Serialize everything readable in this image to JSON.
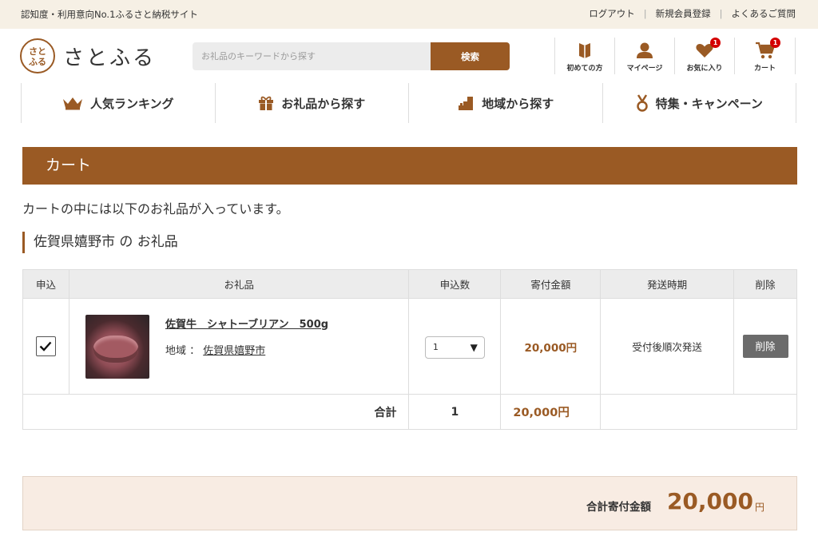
{
  "topbar": {
    "tagline": "認知度・利用意向No.1ふるさと納税サイト",
    "links": [
      "ログアウト",
      "新規会員登録",
      "よくあるご質問"
    ]
  },
  "header": {
    "logo_mark": "さとふる",
    "logo_text": "さとふる",
    "search_placeholder": "お礼品のキーワードから探す",
    "search_button": "検索",
    "icons": [
      {
        "label": "初めての方",
        "icon": "book-icon"
      },
      {
        "label": "マイページ",
        "icon": "user-icon"
      },
      {
        "label": "お気に入り",
        "icon": "heart-icon",
        "badge": "1"
      },
      {
        "label": "カート",
        "icon": "cart-icon",
        "badge": "1"
      }
    ]
  },
  "nav": [
    {
      "label": "人気ランキング",
      "icon": "crown-icon"
    },
    {
      "label": "お礼品から探す",
      "icon": "gift-icon"
    },
    {
      "label": "地域から探す",
      "icon": "map-icon"
    },
    {
      "label": "特集・キャンペーン",
      "icon": "medal-icon"
    }
  ],
  "cart": {
    "title": "カート",
    "intro": "カートの中には以下のお礼品が入っています。",
    "municipality_heading": "佐賀県嬉野市 の お礼品",
    "columns": [
      "申込",
      "お礼品",
      "申込数",
      "寄付金額",
      "発送時期",
      "削除"
    ],
    "items": [
      {
        "checked": true,
        "name": "佐賀牛　シャトーブリアン　500g",
        "region_label": "地域 ：",
        "region": "佐賀県嬉野市",
        "quantity": "1",
        "amount": "20,000円",
        "shipping": "受付後順次発送",
        "delete_label": "削除"
      }
    ],
    "total_label": "合計",
    "total_quantity": "1",
    "total_amount": "20,000円"
  },
  "grand_total": {
    "label": "合計寄付金額",
    "value": "20,000",
    "unit": "円"
  },
  "colors": {
    "brand": "#9a5a24",
    "topbar_bg": "#f6f0e5",
    "badge": "#d40000",
    "grand_bg": "#f8ece3"
  }
}
